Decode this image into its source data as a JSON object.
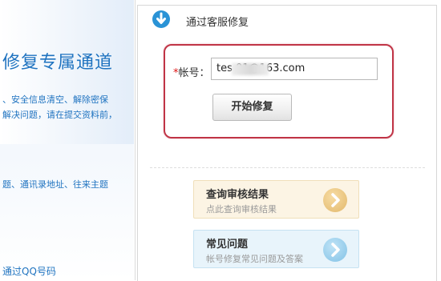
{
  "left": {
    "title": "修复专属通道",
    "desc_line1": "、安全信息清空、解除密保",
    "desc_line2": "解决问题，请在提交资料前，",
    "desc_line3": "题、通讯录地址、往来主题",
    "link": "通过QQ号码"
  },
  "section": {
    "title": "通过客服修复",
    "icon": "down-arrow-circle-icon"
  },
  "form": {
    "required_mark": "*",
    "account_label": "帐号：",
    "account_value": "tes        01@163.com",
    "start_button": "开始修复"
  },
  "cards": [
    {
      "title": "查询审核结果",
      "subtitle": "点此查询审核结果",
      "icon": "chevron-right-icon"
    },
    {
      "title": "常见问题",
      "subtitle": "帐号修复常见问题及答案",
      "icon": "chevron-right-icon"
    }
  ],
  "colors": {
    "accent_blue": "#1f73c0",
    "frame_red": "#c03446",
    "card1_bg": "#fcf4e4",
    "card2_bg": "#e8f4fb"
  }
}
